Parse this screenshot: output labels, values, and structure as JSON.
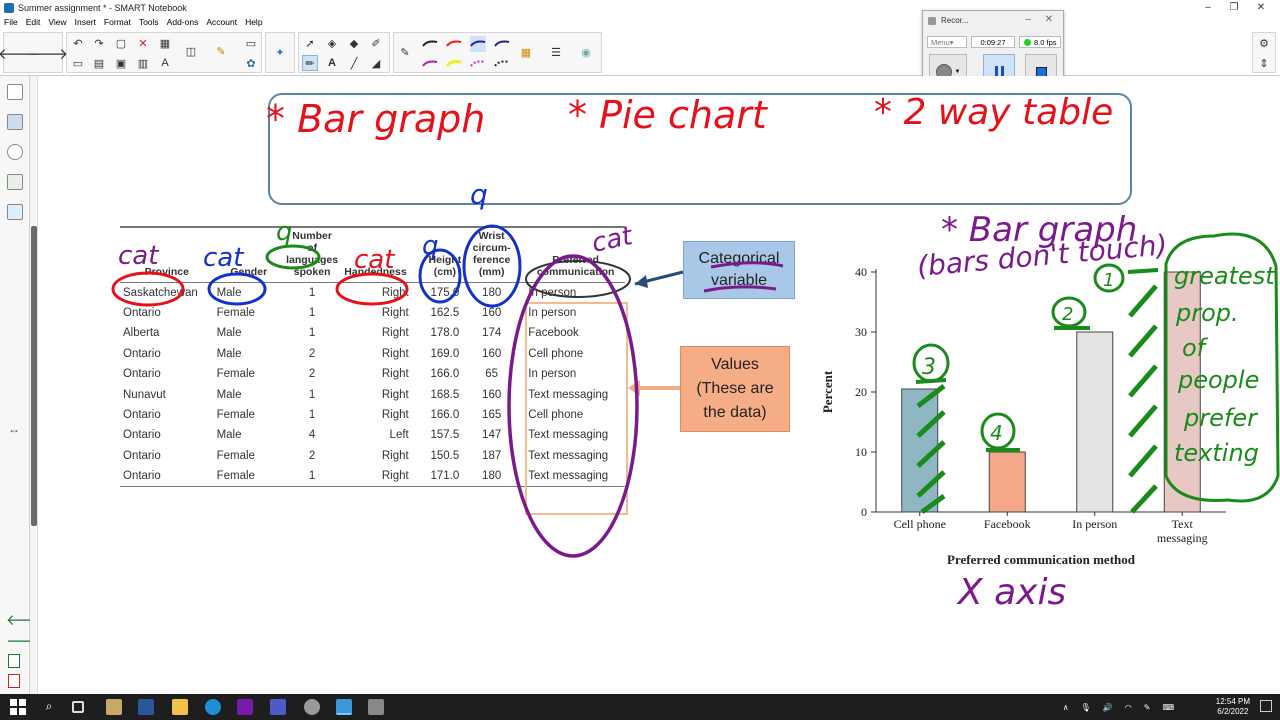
{
  "window": {
    "title": "Summer assignment * - SMART Notebook",
    "controls": {
      "minimize": "–",
      "maximize": "❐",
      "close": "✕"
    }
  },
  "menu": [
    "File",
    "Edit",
    "View",
    "Insert",
    "Format",
    "Tools",
    "Add-ons",
    "Account",
    "Help"
  ],
  "recorder": {
    "title": "Recor...",
    "mode": "Menu▾",
    "elapsed": "0:09:27",
    "fps": "8.0 fps"
  },
  "table": {
    "headers": [
      "Province",
      "Gender",
      "Number of languages spoken",
      "Handedness",
      "Height (cm)",
      "Wrist circum-ference (mm)",
      "Preferred communication"
    ],
    "rows": [
      [
        "Saskatchewan",
        "Male",
        "1",
        "Right",
        "175.0",
        "180",
        "In person"
      ],
      [
        "Ontario",
        "Female",
        "1",
        "Right",
        "162.5",
        "160",
        "In person"
      ],
      [
        "Alberta",
        "Male",
        "1",
        "Right",
        "178.0",
        "174",
        "Facebook"
      ],
      [
        "Ontario",
        "Male",
        "2",
        "Right",
        "169.0",
        "160",
        "Cell phone"
      ],
      [
        "Ontario",
        "Female",
        "2",
        "Right",
        "166.0",
        "65",
        "In person"
      ],
      [
        "Nunavut",
        "Male",
        "1",
        "Right",
        "168.5",
        "160",
        "Text messaging"
      ],
      [
        "Ontario",
        "Female",
        "1",
        "Right",
        "166.0",
        "165",
        "Cell phone"
      ],
      [
        "Ontario",
        "Male",
        "4",
        "Left",
        "157.5",
        "147",
        "Text messaging"
      ],
      [
        "Ontario",
        "Female",
        "2",
        "Right",
        "150.5",
        "187",
        "Text messaging"
      ],
      [
        "Ontario",
        "Female",
        "1",
        "Right",
        "171.0",
        "180",
        "Text messaging"
      ]
    ]
  },
  "callouts": {
    "categorical": {
      "line1": "Categorical",
      "line2": "variable"
    },
    "values": {
      "line1": "Values",
      "line2": "(These are",
      "line3": "the data)"
    }
  },
  "chart_data": {
    "type": "bar",
    "categories": [
      "Cell phone",
      "Facebook",
      "In person",
      "Text messaging"
    ],
    "values": [
      20.5,
      10,
      30,
      40
    ],
    "colors": [
      "#8fb6c3",
      "#f4a888",
      "#e4e4e4",
      "#e8c8c4"
    ],
    "xlabel": "Preferred communication method",
    "ylabel": "Percent",
    "ylim": [
      0,
      40
    ],
    "yticks": [
      0,
      10,
      20,
      30,
      40
    ],
    "grid": false
  },
  "annotations": {
    "bar_graph": "* Bar graph",
    "pie_chart": "* Pie chart",
    "two_way": "* 2 way table",
    "cat": "cat",
    "q": "q",
    "chart_title": "* Bar graph",
    "chart_sub": "(bars don't touch)",
    "rank": [
      "3",
      "4",
      "2",
      "1"
    ],
    "greatest": [
      "greatest",
      "prop.",
      "of",
      "people",
      "prefer",
      "texting"
    ],
    "x_axis": "X axis"
  },
  "taskbar": {
    "time": "12:54 PM",
    "date": "6/2/2022"
  },
  "colors": {
    "ink_red": "#e3121b",
    "ink_blue": "#1432c8",
    "ink_green": "#1a8a1a",
    "ink_purple": "#7a1a8c",
    "box_border": "#5b86a8"
  }
}
